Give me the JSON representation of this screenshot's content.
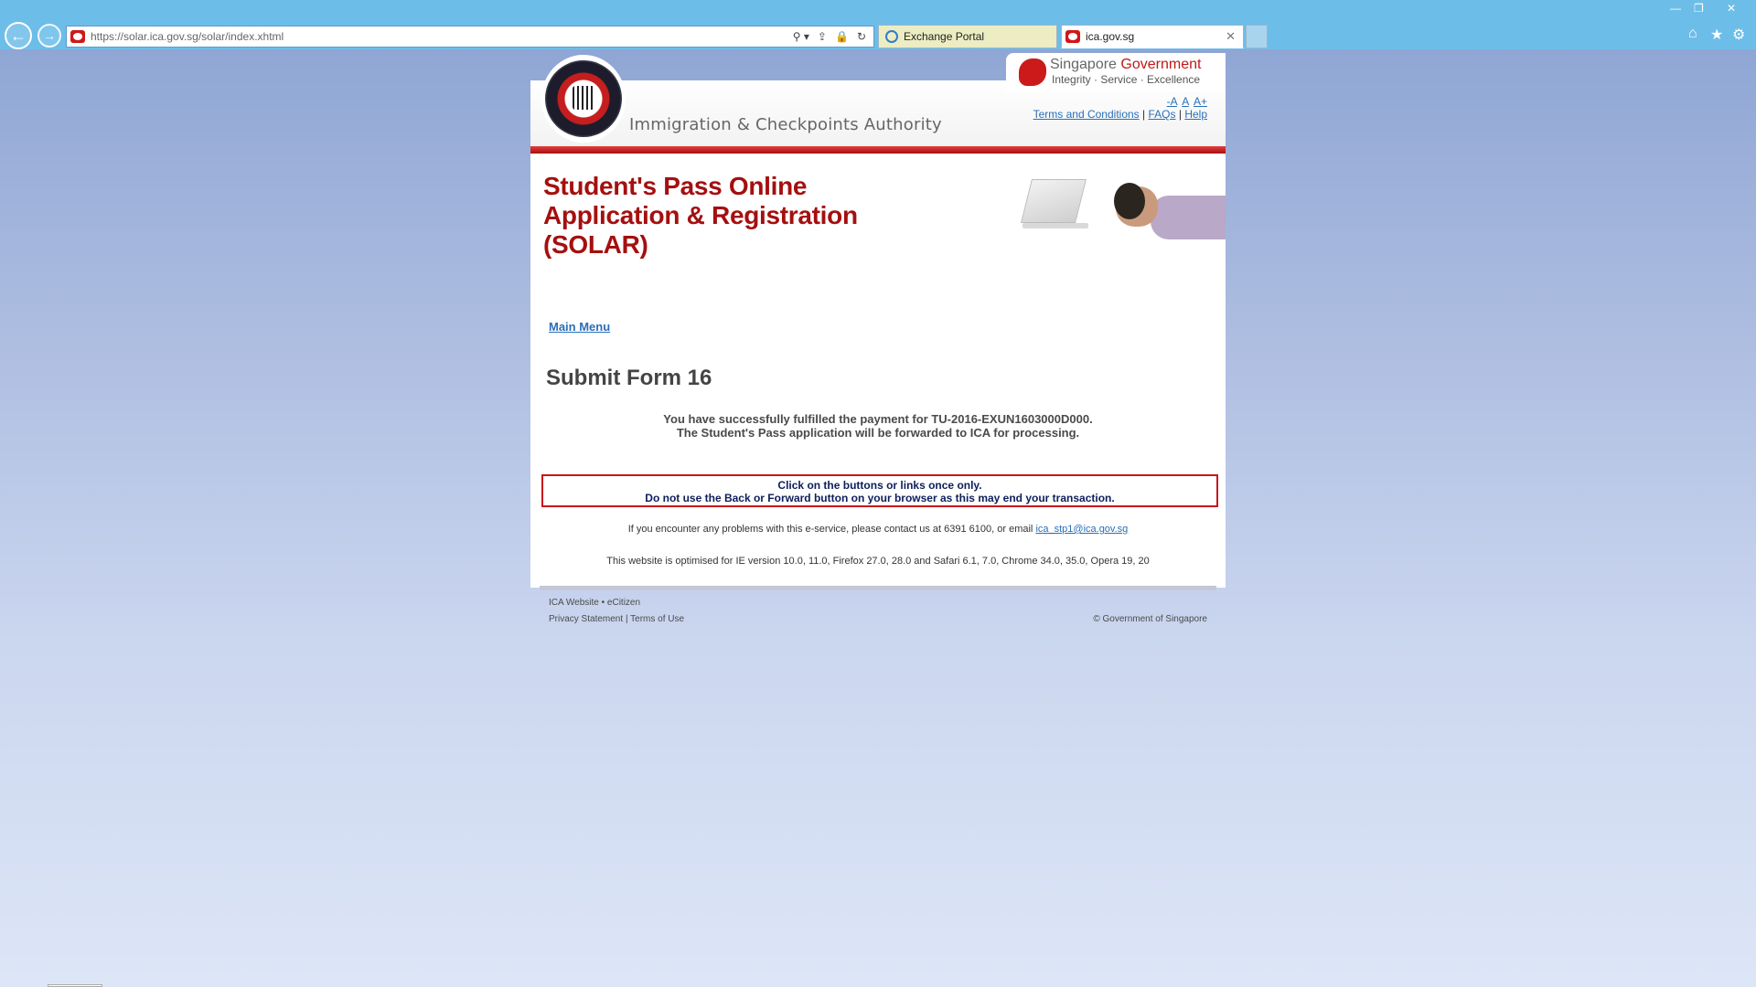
{
  "browser": {
    "url": "https://solar.ica.gov.sg/solar/index.xhtml",
    "tabs": [
      {
        "label": "Exchange Portal",
        "active": false
      },
      {
        "label": "ica.gov.sg",
        "active": true
      }
    ],
    "tab_close": "✕",
    "window_controls": {
      "minimize": "—",
      "restore": "❐",
      "close": "✕"
    },
    "nav": {
      "back": "←",
      "forward": "→"
    },
    "address_tools": {
      "search": "⚲ ▾",
      "share": "⇪",
      "lock": "🔒",
      "refresh": "↻"
    },
    "toolbar": {
      "home": "⌂",
      "favorites": "★",
      "settings": "⚙"
    }
  },
  "header": {
    "agency_name": "Immigration & Checkpoints Authority",
    "gov_title_1": "Singapore ",
    "gov_title_2": "Government",
    "gov_motto": "Integrity · Service · Excellence",
    "font_small": "-A",
    "font_normal": "A",
    "font_large": "A+",
    "links": {
      "terms": "Terms and Conditions",
      "faqs": "FAQs",
      "help": "Help",
      "separator": "|"
    }
  },
  "main": {
    "title_line1": "Student's Pass Online",
    "title_line2": "Application & Registration",
    "title_line3": "(SOLAR)",
    "main_menu": "Main Menu",
    "form_title": "Submit Form 16",
    "success_line1": "You have successfully fulfilled the payment for TU-2016-EXUN1603000D000.",
    "success_line2": "The Student's Pass application will be forwarded to ICA for processing.",
    "warning_line1": "Click on the buttons or links once only.",
    "warning_line2": "Do not use the Back or Forward button on your browser as this may end your transaction.",
    "contact_prefix": "If you encounter any problems with this e-service, please contact us at 6391 6100, or email ",
    "contact_email": "ica_stp1@ica.gov.sg",
    "browser_note": "This website is optimised for IE version 10.0, 11.0, Firefox 27.0, 28.0 and Safari 6.1, 7.0, Chrome 34.0, 35.0, Opera 19, 20"
  },
  "footer": {
    "ica_website": "ICA Website",
    "bullet": "•",
    "ecitizen": "eCitizen",
    "privacy": "Privacy Statement",
    "separator": "|",
    "terms_of_use": "Terms of Use",
    "copyright": "© Government of Singapore"
  },
  "colors": {
    "brand_red": "#a50f0f",
    "link_blue": "#2a6fb8",
    "warning_border": "#c8161c"
  }
}
